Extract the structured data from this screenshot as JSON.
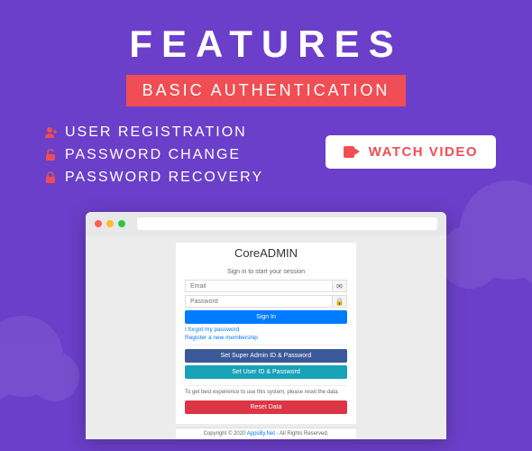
{
  "hero": {
    "title": "FEATURES",
    "subtitle": "BASIC AUTHENTICATION"
  },
  "features": [
    "USER REGISTRATION",
    "PASSWORD CHANGE",
    "PASSWORD RECOVERY"
  ],
  "watch_button": "WATCH VIDEO",
  "app": {
    "title": "CoreADMIN",
    "session_text": "Sign in to start your session",
    "email_placeholder": "Email",
    "password_placeholder": "Password",
    "signin": "Sign In",
    "forgot": "I forgot my password",
    "register": "Register a new membership",
    "set_super": "Set Super Admin ID & Password",
    "set_user": "Set User ID & Password",
    "reset_text": "To get best experience to use this system, please reset the data.",
    "reset_btn": "Reset Data",
    "copyright_pre": "Copyright © 2020 ",
    "copyright_brand": "AppsBy.Net",
    "copyright_post": " - All Rights Reserved."
  }
}
